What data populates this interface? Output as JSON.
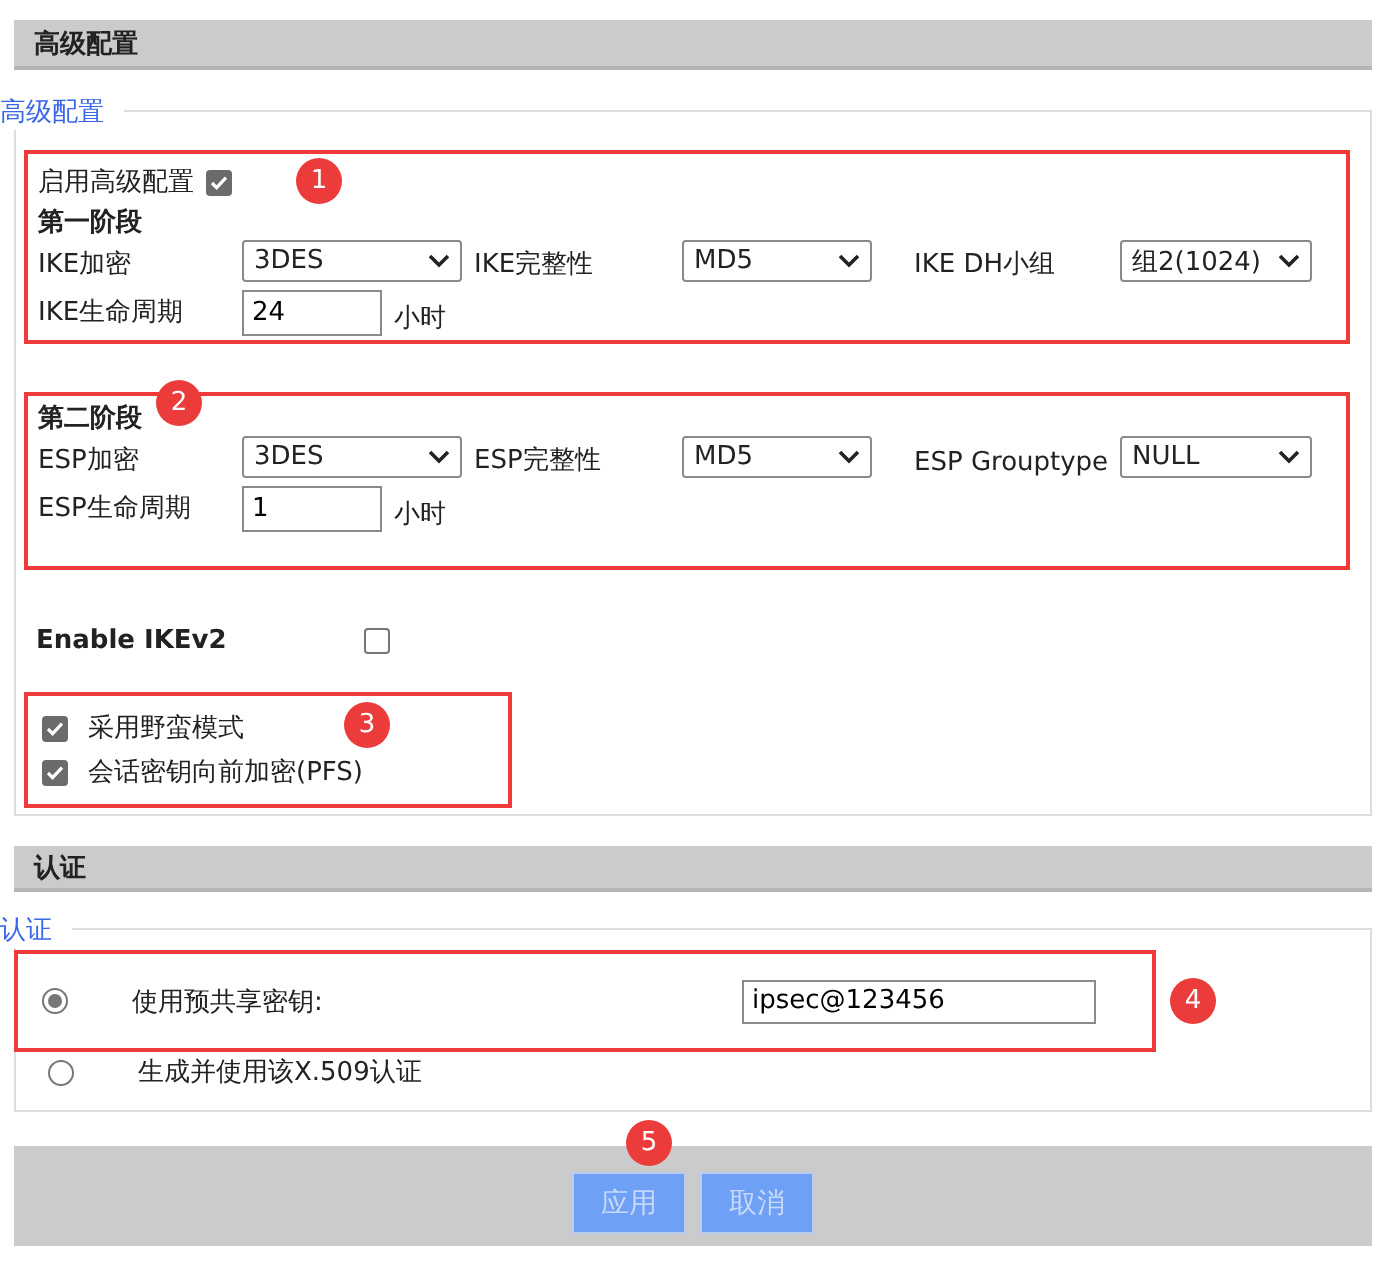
{
  "advanced_header": {
    "title": "高级配置"
  },
  "advanced": {
    "legend": "高级配置",
    "box1": {
      "badge": "1",
      "enable": {
        "label": "启用高级配置",
        "checked": true
      },
      "phase": {
        "title": "第一阶段",
        "selects": [
          {
            "label": "IKE加密",
            "value": "3DES"
          },
          {
            "label": "IKE完整性",
            "value": "MD5"
          },
          {
            "label": "IKE DH小组",
            "value": "组2(1024)"
          }
        ],
        "lifetime": {
          "label": "IKE生命周期",
          "value": "24",
          "unit": "小时"
        }
      }
    },
    "box2": {
      "badge": "2",
      "phase": {
        "title": "第二阶段",
        "selects": [
          {
            "label": "ESP加密",
            "value": "3DES"
          },
          {
            "label": "ESP完整性",
            "value": "MD5"
          },
          {
            "label": "ESP Grouptype",
            "value": "NULL"
          }
        ],
        "lifetime": {
          "label": "ESP生命周期",
          "value": "1",
          "unit": "小时"
        }
      }
    },
    "ikev2": {
      "label": "Enable IKEv2",
      "checked": false
    },
    "box3": {
      "badge": "3",
      "options": [
        {
          "label": "采用野蛮模式",
          "checked": true
        },
        {
          "label": "会话密钥向前加密(PFS)",
          "checked": true
        }
      ]
    }
  },
  "auth_header": {
    "title": "认证"
  },
  "auth": {
    "legend": "认证",
    "box4": {
      "badge": "4"
    },
    "radios": [
      {
        "label": "使用预共享密钥:",
        "selected": true,
        "value": "ipsec@123456"
      },
      {
        "label": "生成并使用该X.509认证",
        "selected": false
      }
    ]
  },
  "footer": {
    "badge": "5",
    "buttons": [
      {
        "label": "应用",
        "disabled": true
      },
      {
        "label": "取消",
        "disabled": true
      }
    ]
  }
}
